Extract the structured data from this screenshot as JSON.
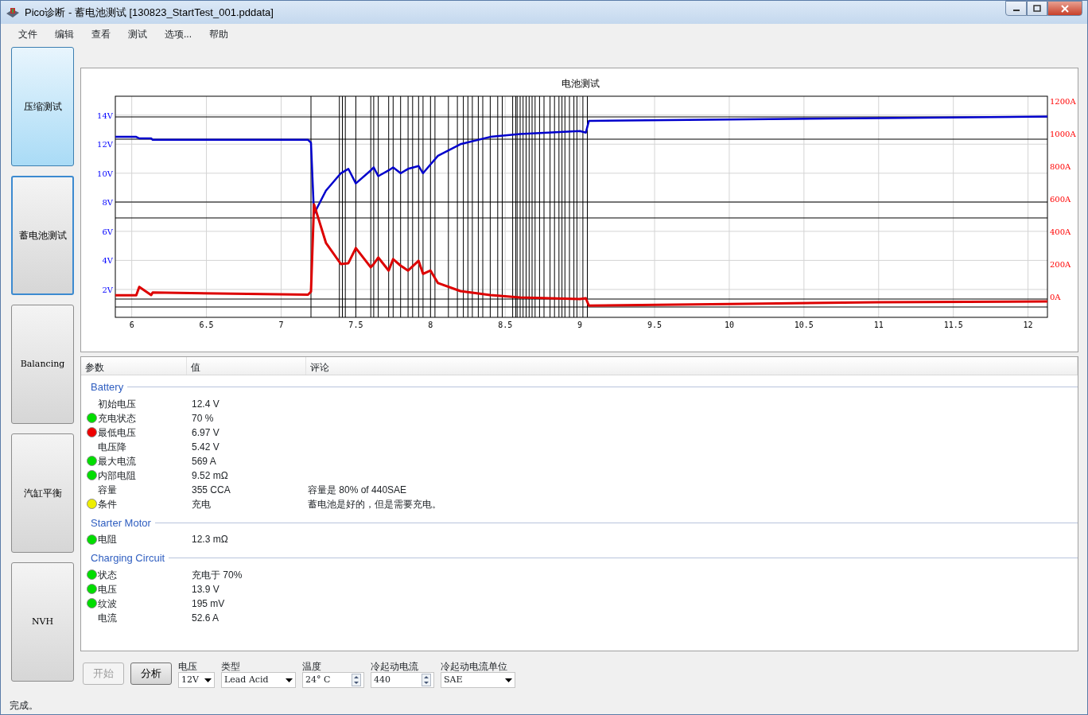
{
  "window": {
    "title": "Pico诊断 - 蓄电池测试 [130823_StartTest_001.pddata]"
  },
  "menu": [
    "文件",
    "编辑",
    "查看",
    "测试",
    "选项...",
    "帮助"
  ],
  "sidebar": {
    "items": [
      {
        "label": "压缩测试",
        "selected": false,
        "hovered": true
      },
      {
        "label": "蓄电池测试",
        "selected": true,
        "hovered": false
      },
      {
        "label": "Balancing",
        "selected": false,
        "hovered": false
      },
      {
        "label": "汽缸平衡",
        "selected": false,
        "hovered": false
      },
      {
        "label": "NVH",
        "selected": false,
        "hovered": false
      }
    ]
  },
  "chart": {
    "chart_data": {
      "type": "line",
      "title": "电池测试",
      "grid": true,
      "x": [
        5.89,
        6.03,
        6.05,
        6.13,
        6.14,
        7.18,
        7.2,
        7.22,
        7.3,
        7.4,
        7.45,
        7.5,
        7.6,
        7.62,
        7.65,
        7.72,
        7.75,
        7.8,
        7.85,
        7.92,
        7.95,
        8.0,
        8.05,
        8.2,
        8.4,
        8.6,
        9.0,
        9.04,
        9.06,
        10,
        11,
        12.13
      ],
      "series": [
        {
          "color": "#0000cc",
          "values": [
            12.5,
            12.5,
            12.4,
            12.4,
            12.3,
            12.3,
            12.1,
            7.2,
            8.8,
            10.0,
            10.3,
            9.3,
            10.2,
            10.4,
            9.8,
            10.2,
            10.4,
            10.0,
            10.3,
            10.5,
            10.0,
            10.6,
            11.2,
            12.0,
            12.5,
            12.7,
            12.9,
            12.8,
            13.6,
            13.7,
            13.8,
            13.9
          ]
        },
        {
          "color": "#dd0000",
          "axis": "y2",
          "values": [
            8,
            8,
            60,
            10,
            25,
            12,
            30,
            566,
            330,
            200,
            205,
            298,
            180,
            200,
            240,
            160,
            230,
            190,
            160,
            220,
            140,
            160,
            83,
            34,
            10,
            -5,
            -15,
            -10,
            -55,
            -45,
            -35,
            -29
          ]
        }
      ],
      "xlim": [
        5.89,
        12.13
      ],
      "ylim": [
        0.08,
        15.3
      ],
      "y2lim": [
        -127,
        1229
      ],
      "xticks": [
        {
          "value": 6,
          "label": "6"
        },
        {
          "value": 6.5,
          "label": "6.5"
        },
        {
          "value": 7,
          "label": "7"
        },
        {
          "value": 7.5,
          "label": "7.5"
        },
        {
          "value": 8,
          "label": "8"
        },
        {
          "value": 8.5,
          "label": "8.5"
        },
        {
          "value": 9,
          "label": "9"
        },
        {
          "value": 9.5,
          "label": "9.5"
        },
        {
          "value": 10,
          "label": "10"
        },
        {
          "value": 10.5,
          "label": "10.5"
        },
        {
          "value": 11,
          "label": "11"
        },
        {
          "value": 11.5,
          "label": "11.5"
        },
        {
          "value": 12,
          "label": "12"
        }
      ],
      "yticks": [
        {
          "value": 2,
          "label": "2V"
        },
        {
          "value": 4,
          "label": "4V"
        },
        {
          "value": 6,
          "label": "6V"
        },
        {
          "value": 8,
          "label": "8V"
        },
        {
          "value": 10,
          "label": "10V"
        },
        {
          "value": 12,
          "label": "12V"
        },
        {
          "value": 14,
          "label": "14V"
        }
      ],
      "y2ticks": [
        {
          "value": 0,
          "label": "0A"
        },
        {
          "value": 200,
          "label": "200A"
        },
        {
          "value": 400,
          "label": "400A"
        },
        {
          "value": 600,
          "label": "600A"
        },
        {
          "value": 800,
          "label": "800A"
        },
        {
          "value": 1000,
          "label": "1000A"
        },
        {
          "value": 1200,
          "label": "1200A"
        }
      ]
    }
  },
  "results": {
    "columns": [
      "参数",
      "值",
      "评论"
    ],
    "groups": [
      {
        "title": "Battery",
        "rows": [
          {
            "name": "初始电压",
            "value": "12.4 V"
          },
          {
            "name": "充电状态",
            "value": "70 %",
            "color": "#00dd00"
          },
          {
            "name": "最低电压",
            "value": "6.97 V",
            "color": "#ee0000"
          },
          {
            "name": "电压降",
            "value": "5.42 V"
          },
          {
            "name": "最大电流",
            "value": "569 A",
            "color": "#00dd00"
          },
          {
            "name": "内部电阻",
            "value": "9.52 mΩ",
            "color": "#00dd00"
          },
          {
            "name": "容量",
            "value": "355 CCA",
            "comment": "容量是 80% of 440SAE"
          },
          {
            "name": "条件",
            "value": "充电",
            "comment": "蓄电池是好的，但是需要充电。",
            "color": "#eeee00"
          }
        ]
      },
      {
        "title": "Starter Motor",
        "rows": [
          {
            "name": "电阻",
            "value": "12.3 mΩ",
            "color": "#00dd00"
          }
        ]
      },
      {
        "title": "Charging Circuit",
        "rows": [
          {
            "name": "状态",
            "value": "充电于 70%",
            "color": "#00dd00"
          },
          {
            "name": "电压",
            "value": "13.9 V",
            "color": "#00dd00"
          },
          {
            "name": "纹波",
            "value": "195 mV",
            "color": "#00dd00"
          },
          {
            "name": "电流",
            "value": "52.6 A"
          }
        ]
      }
    ]
  },
  "controls": {
    "buttons": [
      {
        "label": "开始",
        "disabled": true
      },
      {
        "label": "分析",
        "disabled": false
      }
    ],
    "fields": [
      {
        "kind": "select",
        "label": "电压",
        "value": "12V"
      },
      {
        "kind": "select",
        "label": "类型",
        "value": "Lead Acid"
      },
      {
        "kind": "spinner",
        "label": "温度",
        "value": "24° C"
      },
      {
        "kind": "spinner",
        "label": "冷起动电流",
        "value": "440"
      },
      {
        "kind": "select",
        "label": "冷起动电流单位",
        "value": "SAE"
      }
    ]
  },
  "status_bar": "完成。"
}
